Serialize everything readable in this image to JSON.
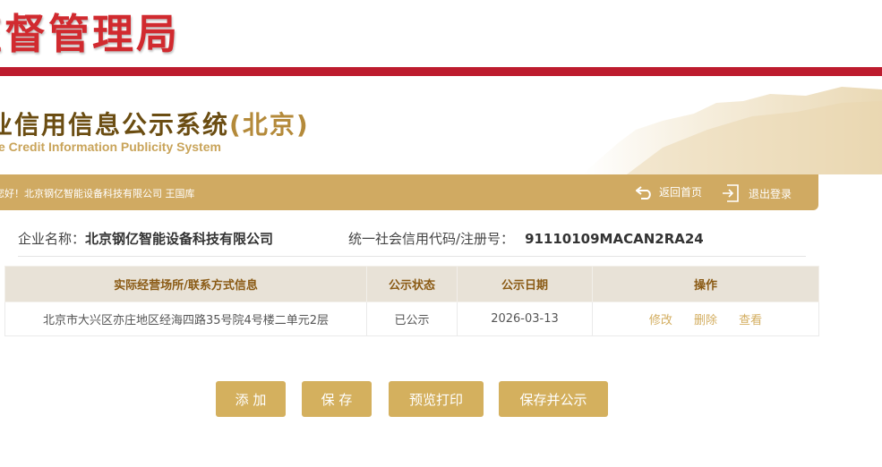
{
  "header": {
    "agency": "监督管理局",
    "system_title": "业信用信息公示系统",
    "system_region": "(北京)",
    "system_en": "e Credit Information Publicity System"
  },
  "bar": {
    "greeting": "您好！北京钢亿智能设备科技有限公司  王国库",
    "home": "返回首页",
    "logout": "退出登录"
  },
  "company": {
    "name_label": "企业名称：",
    "name": "北京钢亿智能设备科技有限公司",
    "code_label": "统一社会信用代码/注册号：",
    "code": "91110109MACAN2RA24"
  },
  "table": {
    "headers": [
      "实际经营场所/联系方式信息",
      "公示状态",
      "公示日期",
      "操作"
    ],
    "rows": [
      {
        "address": "北京市大兴区亦庄地区经海四路35号院4号楼二单元2层",
        "status": "已公示",
        "date": "2026-03-13",
        "actions": [
          "修改",
          "删除",
          "查看"
        ]
      }
    ]
  },
  "buttons": {
    "add": "添 加",
    "save": "保 存",
    "preview": "预览打印",
    "save_publish": "保存并公示"
  },
  "colors": {
    "red": "#bd1c2e",
    "gold": "#d0aa62",
    "button": "#d4b05e"
  }
}
